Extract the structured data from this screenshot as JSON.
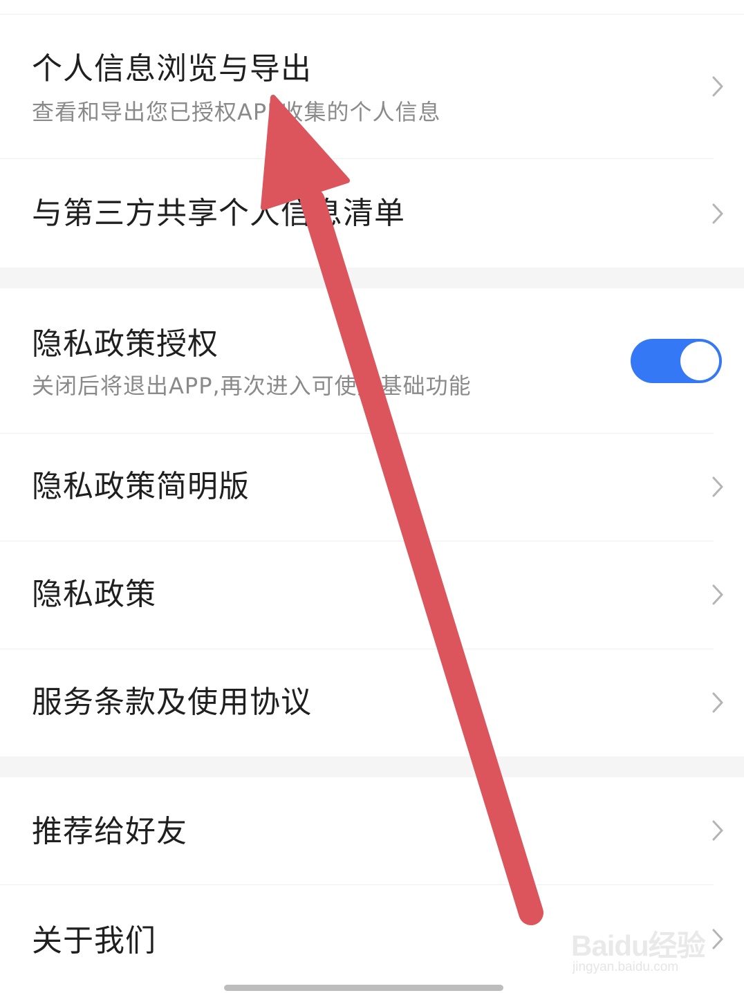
{
  "colors": {
    "accent": "#3478f6",
    "annotation_arrow": "#dc555c",
    "title_text": "#1f1f1f",
    "subtitle_text": "#8a8a8a",
    "section_gap": "#f5f5f5"
  },
  "settings": {
    "personal_info": {
      "title": "个人信息浏览与导出",
      "subtitle": "查看和导出您已授权APP收集的个人信息",
      "icon": "chevron-right-icon"
    },
    "third_party": {
      "title": "与第三方共享个人信息清单",
      "icon": "chevron-right-icon"
    },
    "privacy_auth": {
      "title": "隐私政策授权",
      "subtitle": "关闭后将退出APP,再次进入可使用基础功能",
      "toggle_on": true
    },
    "privacy_brief": {
      "title": "隐私政策简明版",
      "icon": "chevron-right-icon"
    },
    "privacy_policy": {
      "title": "隐私政策",
      "icon": "chevron-right-icon"
    },
    "terms": {
      "title": "服务条款及使用协议",
      "icon": "chevron-right-icon"
    },
    "recommend": {
      "title": "推荐给好友",
      "icon": "chevron-right-icon"
    },
    "about": {
      "title": "关于我们",
      "icon": "chevron-right-icon"
    }
  },
  "watermark": {
    "logo": "Baidu经验",
    "url": "jingyan.baidu.com"
  }
}
